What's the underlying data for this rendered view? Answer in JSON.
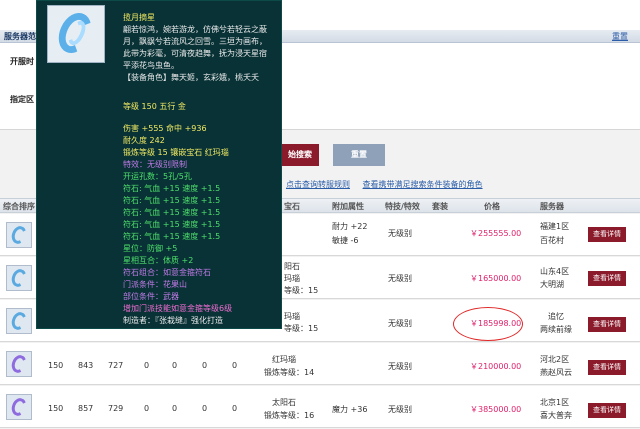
{
  "server_section": {
    "label": "服务器范",
    "reset_link": "重置"
  },
  "row_labels": {
    "open_time": "开服时",
    "designated": "指定区"
  },
  "buttons": {
    "search": "始搜索",
    "reset": "重置"
  },
  "links": [
    "点击查询转服规则",
    "查看携带满足搜索条件装备的角色"
  ],
  "table_headers": {
    "rank": "综合排序",
    "gem": "宝石",
    "attr": "附加属性",
    "special": "特技/特效",
    "set": "套装",
    "price": "价格",
    "server": "服务器"
  },
  "rows": [
    {
      "gem": "",
      "attr": "耐力 +22\n敏捷 -6",
      "special": "无级别",
      "price": "￥255555.00",
      "server": "福建1区\n百花村",
      "detail": "查看详情",
      "c1": "",
      "c2": "",
      "c3": "",
      "c4": "",
      "c5": "",
      "c6": "",
      "c7": ""
    },
    {
      "gem": "阳石\n玛瑙\n等级：15",
      "attr": "",
      "special": "无级别",
      "price": "￥165000.00",
      "server": "山东4区\n大明湖",
      "detail": "查看详情"
    },
    {
      "gem": "玛瑙\n等级：15",
      "attr": "",
      "special": "无级别",
      "price": "￥185998.00",
      "server": "追忆\n两续前缘",
      "detail": "查看详情"
    },
    {
      "c1": "150",
      "c2": "843",
      "c3": "727",
      "c4": "0",
      "c5": "0",
      "c6": "0",
      "c7": "0",
      "gem": "红玛瑙\n锻炼等级：14",
      "attr": "",
      "special": "无级别",
      "price": "￥210000.00",
      "server": "河北2区\n燕赵风云",
      "detail": "查看详情"
    },
    {
      "c1": "150",
      "c2": "857",
      "c3": "729",
      "c4": "0",
      "c5": "0",
      "c6": "0",
      "c7": "0",
      "gem": "太阳石\n锻炼等级：16",
      "attr": "魔力 +36",
      "special": "无级别",
      "price": "￥385000.00",
      "server": "北京1区\n喜大普奔",
      "detail": "查看详情"
    }
  ],
  "tooltip": {
    "title": "揽月摘星",
    "desc": [
      "翩若惊鸿，婉若游龙，仿佛兮若轻云之蔽",
      "月，飘飖兮若流风之回雪。三垣为画布，",
      "此带为彩毫，可清夜趋舞，抚为浸天星宿",
      "平添花鸟虫鱼。",
      "【装备角色】舞天姬，玄彩娥，桃夭夭"
    ],
    "level_line": "等级 150  五行 金",
    "stat_lines": [
      "伤害 +555  命中 +936",
      "耐久度 242",
      "锻炼等级 15  镶嵌宝石 红玛瑙"
    ],
    "effect_line": "特效：无级别限制",
    "holes_line": "开运孔数：5孔/5孔",
    "runes": [
      "符石: 气血 +15 速度 +1.5",
      "符石: 气血 +15 速度 +1.5",
      "符石: 气血 +15 速度 +1.5",
      "符石: 气血 +15 速度 +1.5",
      "符石: 气血 +15 速度 +1.5"
    ],
    "star_line": "星位：防御 +5",
    "star_match": "星相互合：体质 +2",
    "combo_lines": [
      "符石组合：如意金箍符石",
      "门派条件：花果山",
      "部位条件：武器",
      "增加门派技能如意金箍等级6级"
    ],
    "maker": "制造者：『张栽缝』强化打造"
  },
  "colors": {
    "accent_red": "#8b1a2b",
    "price_pink": "#e0206a",
    "tooltip_bg": "#083236",
    "circle_red": "#e02828"
  }
}
